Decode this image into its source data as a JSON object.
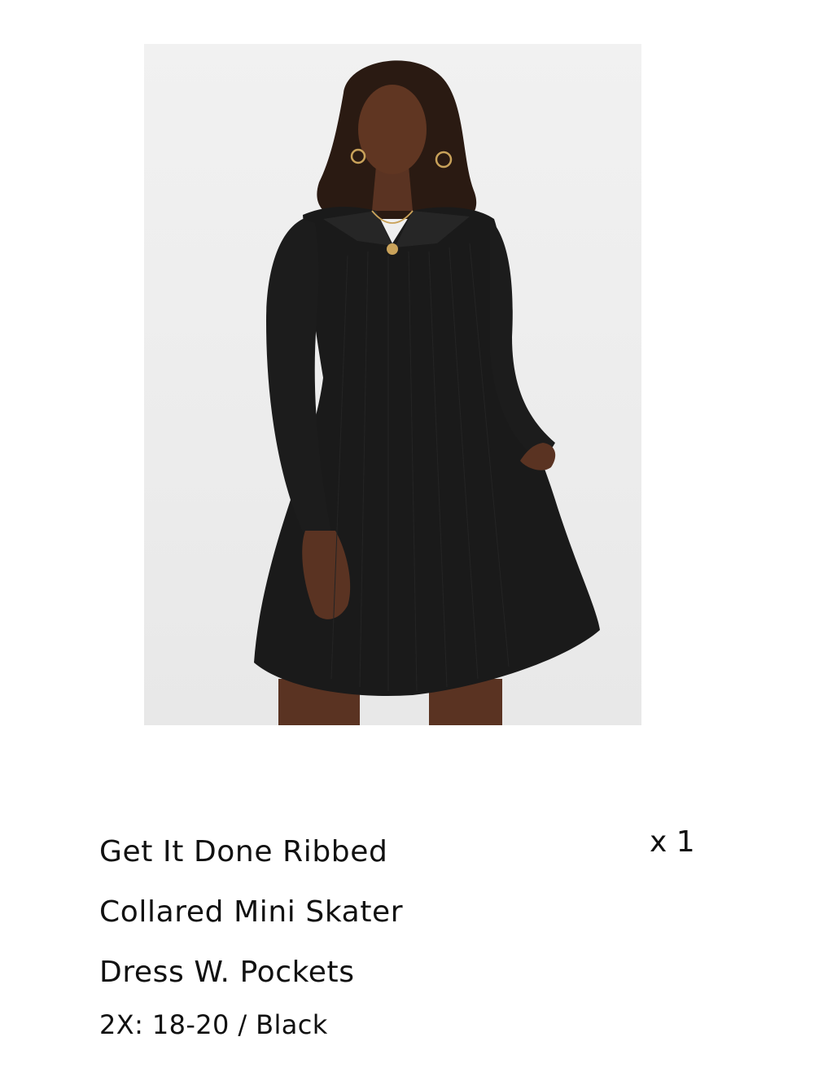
{
  "product": {
    "title_lines": [
      "Get It Done Ribbed",
      "Collared Mini Skater",
      "Dress W. Pockets"
    ],
    "quantity": "x 1",
    "variant": "2X: 18-20 / Black",
    "image_alt": "model-wearing-black-ribbed-collared-skater-dress"
  },
  "colors": {
    "text": "#111111",
    "image_background": "#eeeeee",
    "dress": "#1a1a1a",
    "skin": "#5a3322"
  }
}
